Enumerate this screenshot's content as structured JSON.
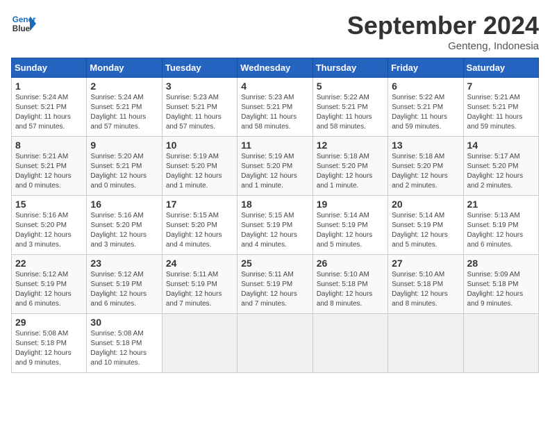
{
  "header": {
    "logo_line1": "General",
    "logo_line2": "Blue",
    "month_title": "September 2024",
    "location": "Genteng, Indonesia"
  },
  "weekdays": [
    "Sunday",
    "Monday",
    "Tuesday",
    "Wednesday",
    "Thursday",
    "Friday",
    "Saturday"
  ],
  "weeks": [
    [
      {
        "day": "1",
        "sunrise": "5:24 AM",
        "sunset": "5:21 PM",
        "daylight": "11 hours and 57 minutes."
      },
      {
        "day": "2",
        "sunrise": "5:24 AM",
        "sunset": "5:21 PM",
        "daylight": "11 hours and 57 minutes."
      },
      {
        "day": "3",
        "sunrise": "5:23 AM",
        "sunset": "5:21 PM",
        "daylight": "11 hours and 57 minutes."
      },
      {
        "day": "4",
        "sunrise": "5:23 AM",
        "sunset": "5:21 PM",
        "daylight": "11 hours and 58 minutes."
      },
      {
        "day": "5",
        "sunrise": "5:22 AM",
        "sunset": "5:21 PM",
        "daylight": "11 hours and 58 minutes."
      },
      {
        "day": "6",
        "sunrise": "5:22 AM",
        "sunset": "5:21 PM",
        "daylight": "11 hours and 59 minutes."
      },
      {
        "day": "7",
        "sunrise": "5:21 AM",
        "sunset": "5:21 PM",
        "daylight": "11 hours and 59 minutes."
      }
    ],
    [
      {
        "day": "8",
        "sunrise": "5:21 AM",
        "sunset": "5:21 PM",
        "daylight": "12 hours and 0 minutes."
      },
      {
        "day": "9",
        "sunrise": "5:20 AM",
        "sunset": "5:21 PM",
        "daylight": "12 hours and 0 minutes."
      },
      {
        "day": "10",
        "sunrise": "5:19 AM",
        "sunset": "5:20 PM",
        "daylight": "12 hours and 1 minute."
      },
      {
        "day": "11",
        "sunrise": "5:19 AM",
        "sunset": "5:20 PM",
        "daylight": "12 hours and 1 minute."
      },
      {
        "day": "12",
        "sunrise": "5:18 AM",
        "sunset": "5:20 PM",
        "daylight": "12 hours and 1 minute."
      },
      {
        "day": "13",
        "sunrise": "5:18 AM",
        "sunset": "5:20 PM",
        "daylight": "12 hours and 2 minutes."
      },
      {
        "day": "14",
        "sunrise": "5:17 AM",
        "sunset": "5:20 PM",
        "daylight": "12 hours and 2 minutes."
      }
    ],
    [
      {
        "day": "15",
        "sunrise": "5:16 AM",
        "sunset": "5:20 PM",
        "daylight": "12 hours and 3 minutes."
      },
      {
        "day": "16",
        "sunrise": "5:16 AM",
        "sunset": "5:20 PM",
        "daylight": "12 hours and 3 minutes."
      },
      {
        "day": "17",
        "sunrise": "5:15 AM",
        "sunset": "5:20 PM",
        "daylight": "12 hours and 4 minutes."
      },
      {
        "day": "18",
        "sunrise": "5:15 AM",
        "sunset": "5:19 PM",
        "daylight": "12 hours and 4 minutes."
      },
      {
        "day": "19",
        "sunrise": "5:14 AM",
        "sunset": "5:19 PM",
        "daylight": "12 hours and 5 minutes."
      },
      {
        "day": "20",
        "sunrise": "5:14 AM",
        "sunset": "5:19 PM",
        "daylight": "12 hours and 5 minutes."
      },
      {
        "day": "21",
        "sunrise": "5:13 AM",
        "sunset": "5:19 PM",
        "daylight": "12 hours and 6 minutes."
      }
    ],
    [
      {
        "day": "22",
        "sunrise": "5:12 AM",
        "sunset": "5:19 PM",
        "daylight": "12 hours and 6 minutes."
      },
      {
        "day": "23",
        "sunrise": "5:12 AM",
        "sunset": "5:19 PM",
        "daylight": "12 hours and 6 minutes."
      },
      {
        "day": "24",
        "sunrise": "5:11 AM",
        "sunset": "5:19 PM",
        "daylight": "12 hours and 7 minutes."
      },
      {
        "day": "25",
        "sunrise": "5:11 AM",
        "sunset": "5:19 PM",
        "daylight": "12 hours and 7 minutes."
      },
      {
        "day": "26",
        "sunrise": "5:10 AM",
        "sunset": "5:18 PM",
        "daylight": "12 hours and 8 minutes."
      },
      {
        "day": "27",
        "sunrise": "5:10 AM",
        "sunset": "5:18 PM",
        "daylight": "12 hours and 8 minutes."
      },
      {
        "day": "28",
        "sunrise": "5:09 AM",
        "sunset": "5:18 PM",
        "daylight": "12 hours and 9 minutes."
      }
    ],
    [
      {
        "day": "29",
        "sunrise": "5:08 AM",
        "sunset": "5:18 PM",
        "daylight": "12 hours and 9 minutes."
      },
      {
        "day": "30",
        "sunrise": "5:08 AM",
        "sunset": "5:18 PM",
        "daylight": "12 hours and 10 minutes."
      },
      null,
      null,
      null,
      null,
      null
    ]
  ]
}
